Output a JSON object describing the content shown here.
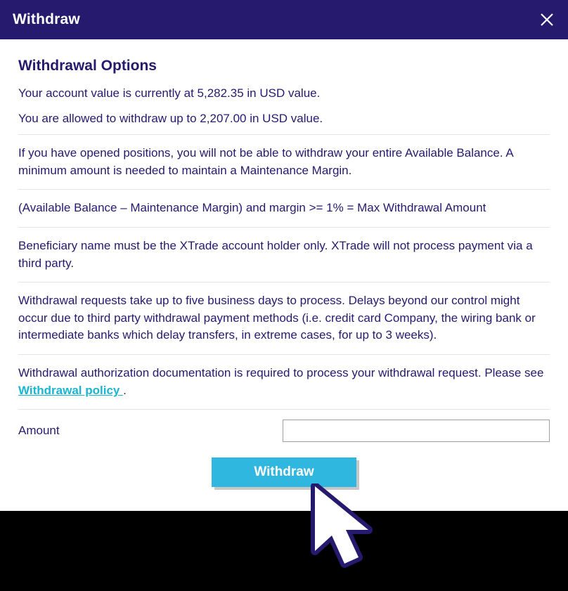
{
  "header": {
    "title": "Withdraw"
  },
  "body": {
    "section_title": "Withdrawal Options",
    "account_value_line": "Your account value is currently at 5,282.35 in USD value.",
    "allowed_line": "You are allowed to withdraw up to 2,207.00 in USD value.",
    "para_positions": "If you have opened positions, you will not be able to withdraw your entire Available Balance. A minimum amount is needed to maintain a Maintenance Margin.",
    "para_formula": "(Available Balance – Maintenance Margin) and margin >= 1% = Max Withdrawal Amount",
    "para_beneficiary": "Beneficiary name must be the XTrade account holder only. XTrade will not process payment via a third party.",
    "para_processing": "Withdrawal requests take up to five business days to process. Delays beyond our control might occur due to third party withdrawal payment methods (i.e. credit card Company, the wiring bank or intermediate banks which delay transfers, in extreme cases, for up to 3 weeks).",
    "para_auth_pre": "Withdrawal authorization documentation is required to process your withdrawal request. Please see ",
    "policy_link_text": "Withdrawal policy ",
    "para_auth_post": ".",
    "amount_label": "Amount",
    "amount_value": "",
    "withdraw_button": "Withdraw"
  }
}
